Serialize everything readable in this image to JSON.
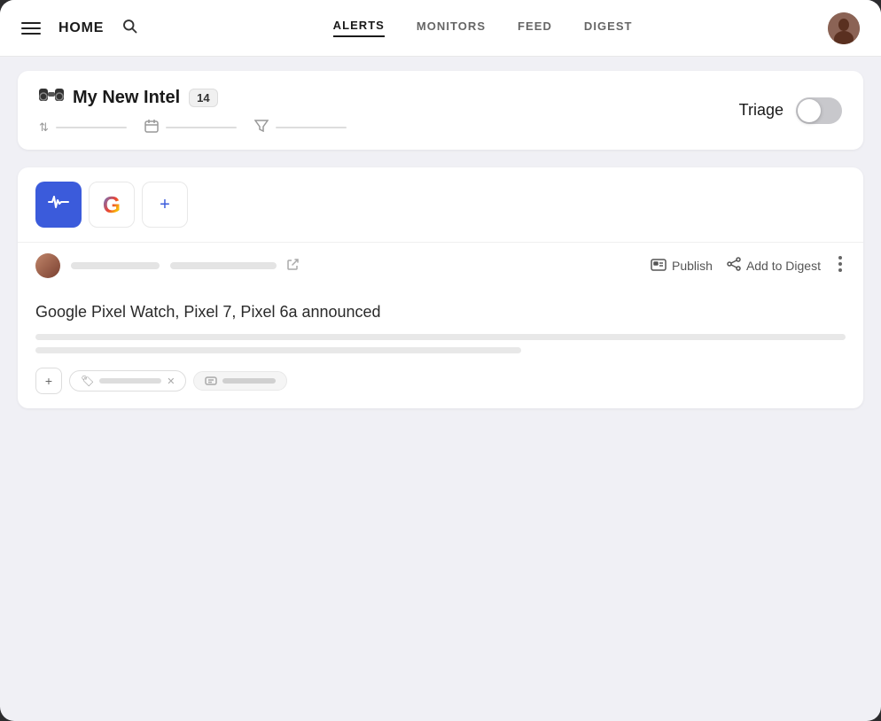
{
  "header": {
    "home_label": "HOME",
    "nav_items": [
      {
        "label": "ALERTS",
        "active": true
      },
      {
        "label": "MONITORS",
        "active": false
      },
      {
        "label": "FEED",
        "active": false
      },
      {
        "label": "DIGEST",
        "active": false
      }
    ]
  },
  "intel_bar": {
    "icon": "👁",
    "title": "My New Intel",
    "badge": "14",
    "triage_label": "Triage",
    "sort_icon": "⇅",
    "calendar_icon": "📅",
    "filter_icon": "⛉"
  },
  "card": {
    "article_title": "Google Pixel Watch, Pixel 7, Pixel 6a announced",
    "publish_label": "Publish",
    "add_to_digest_label": "Add to Digest",
    "add_source_plus": "+"
  }
}
